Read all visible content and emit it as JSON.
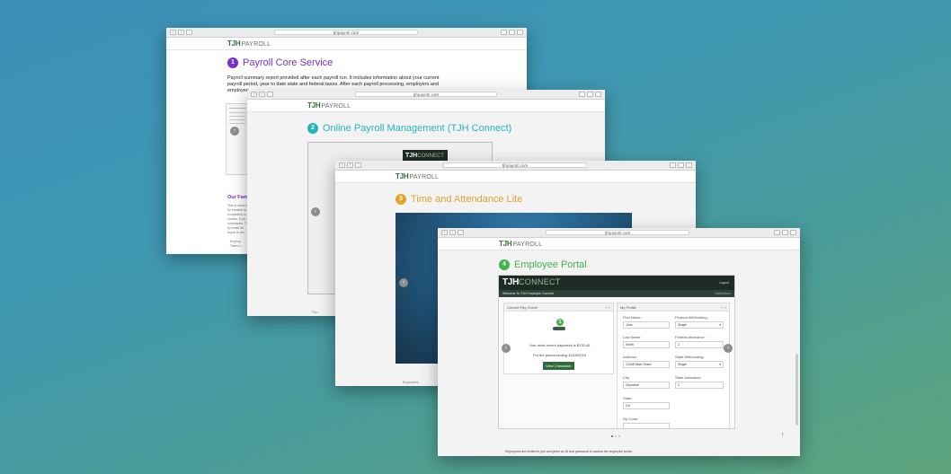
{
  "colors": {
    "brand_green": "#2d6f34",
    "section1_purple": "#7a2fc9",
    "section2_teal": "#27b3c2",
    "section3_gold": "#e2a32a",
    "section4_green": "#43b24a"
  },
  "windows": [
    {
      "url": "tjhpayroll.com",
      "logo": {
        "mark": "TJH",
        "word": "PAYROLL"
      },
      "section": {
        "number": "1",
        "title": "Payroll Core Service",
        "body": "Payroll summary report provided after each payroll run. It includes information about your current payroll period, year to date state and federal taxes. After each payroll processing, employers and employee..."
      },
      "subheading": "Our Fam...",
      "fine_text": [
        "This is used e...",
        "be emailed w...",
        "completion o...",
        "checks. It pe...",
        "summaries. T...",
        "by email for...",
        "report is em..."
      ],
      "bullets": [
        "Employ...",
        "Taxes c..."
      ]
    },
    {
      "url": "tjhpayroll.com",
      "logo": {
        "mark": "TJH",
        "word": "PAYROLL"
      },
      "section": {
        "number": "2",
        "title": "Online Payroll Management (TJH Connect)"
      },
      "preview_logo": {
        "mark": "TJH",
        "word": "CONNECT"
      },
      "bullet": "The..."
    },
    {
      "url": "tjhpayroll.com",
      "logo": {
        "mark": "TJH",
        "word": "PAYROLL"
      },
      "section": {
        "number": "3",
        "title": "Time and Attendance Lite"
      },
      "footer": "Employees..."
    },
    {
      "url": "tjhpayroll.com",
      "logo": {
        "mark": "TJH",
        "word": "PAYROLL"
      },
      "section": {
        "number": "4",
        "title": "Employee Portal"
      },
      "portal": {
        "logo": {
          "mark": "TJH",
          "word": "CONNECT"
        },
        "logout": "Logout",
        "welcome": "Welcome To TJH Employee Connect",
        "welcome_right": "SwitchUser",
        "paycheck_panel": {
          "header": "Current Pay Check",
          "message": "Your most recent paycheck is $133.45",
          "period": "For the period ending 10/15/2016",
          "button": "View Checkstub"
        },
        "profile_panel": {
          "header": "My Profile",
          "first_name": {
            "label": "First Name:",
            "value": "John"
          },
          "last_name": {
            "label": "Last Name:",
            "value": "Smith"
          },
          "address": {
            "label": "Address:",
            "value": "12345 Main Street"
          },
          "city": {
            "label": "City:",
            "value": "Cityname"
          },
          "state": {
            "label": "State:",
            "value": "CA"
          },
          "zip": {
            "label": "Zip Code:",
            "value": ""
          },
          "federal_withholding": {
            "label": "Federal Withholding:",
            "value": "Single"
          },
          "federal_allowance": {
            "label": "Federal Allowance:",
            "value": "2"
          },
          "state_withholding": {
            "label": "State Withholding:",
            "value": "Single"
          },
          "state_allowance": {
            "label": "State Allowance:",
            "value": "2"
          }
        }
      },
      "footer": "Employees are invited to join and given an ID and password to access the employee portal."
    }
  ]
}
